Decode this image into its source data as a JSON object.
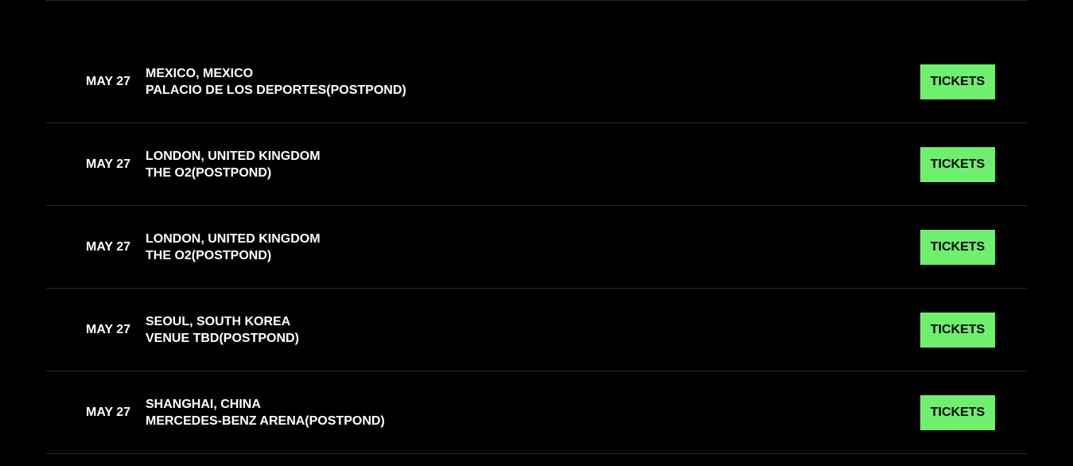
{
  "colors": {
    "background": "#000000",
    "text": "#ffffff",
    "divider": "#2a2a2a",
    "button_bg": "#6ef06e",
    "button_text": "#000000"
  },
  "tour_dates": [
    {
      "date": "MAY 27",
      "location": "MEXICO, MEXICO",
      "venue": "PALACIO DE LOS DEPORTES(POSTPOND)",
      "ticket_label": "TICKETS"
    },
    {
      "date": "MAY 27",
      "location": "LONDON, UNITED KINGDOM",
      "venue": "THE O2(POSTPOND)",
      "ticket_label": "TICKETS"
    },
    {
      "date": "MAY 27",
      "location": "LONDON, UNITED KINGDOM",
      "venue": "THE O2(POSTPOND)",
      "ticket_label": "TICKETS"
    },
    {
      "date": "MAY 27",
      "location": "SEOUL, SOUTH KOREA",
      "venue": "VENUE TBD(POSTPOND)",
      "ticket_label": "TICKETS"
    },
    {
      "date": "MAY 27",
      "location": "SHANGHAI, CHINA",
      "venue": "MERCEDES-BENZ ARENA(POSTPOND)",
      "ticket_label": "TICKETS"
    }
  ]
}
